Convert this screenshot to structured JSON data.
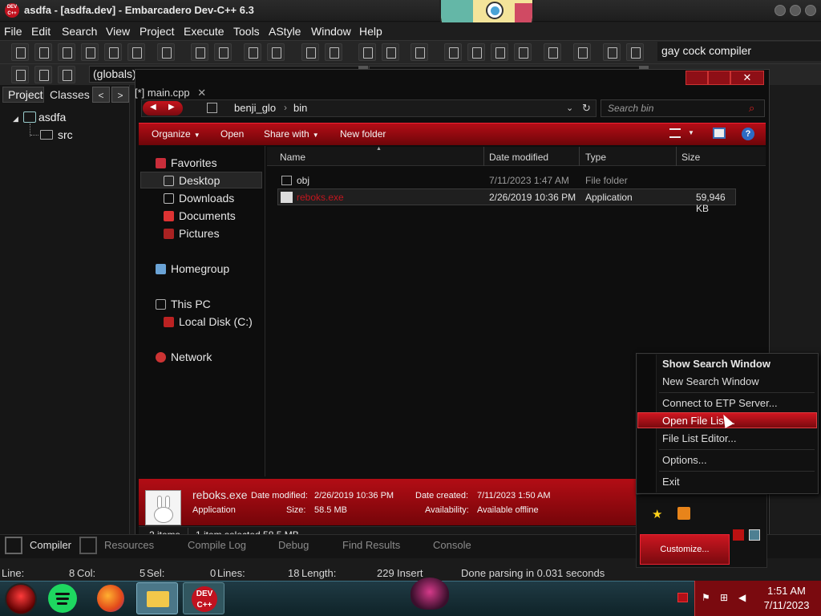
{
  "window": {
    "title": "asdfa - [asdfa.dev] - Embarcadero Dev-C++ 6.3",
    "app_icon_text": "DEV C++"
  },
  "menu": [
    "File",
    "Edit",
    "Search",
    "View",
    "Project",
    "Execute",
    "Tools",
    "AStyle",
    "Window",
    "Help"
  ],
  "toolbar": {
    "compiler": "gay cock compiler",
    "globals": "(globals)"
  },
  "project_panel": {
    "tabs": [
      "Project",
      "Classes"
    ],
    "nav_prev": "<",
    "nav_next": ">",
    "tree": {
      "project": "asdfa",
      "folder": "src"
    }
  },
  "editor": {
    "tab_label": "[*] main.cpp"
  },
  "explorer": {
    "breadcrumb": [
      "benji_glo",
      "bin"
    ],
    "search_placeholder": "Search bin",
    "commands": [
      "Organize",
      "Open",
      "Share with",
      "New folder"
    ],
    "nav": {
      "favorites": "Favorites",
      "desktop": "Desktop",
      "downloads": "Downloads",
      "documents": "Documents",
      "pictures": "Pictures",
      "homegroup": "Homegroup",
      "this_pc": "This PC",
      "local_disk": "Local Disk (C:)",
      "network": "Network"
    },
    "columns": [
      "Name",
      "Date modified",
      "Type",
      "Size"
    ],
    "files": [
      {
        "name": "obj",
        "date": "7/11/2023 1:47 AM",
        "type": "File folder",
        "size": ""
      },
      {
        "name": "reboks.exe",
        "date": "2/26/2019 10:36 PM",
        "type": "Application",
        "size": "59,946 KB"
      }
    ],
    "details": {
      "name": "reboks.exe",
      "kind": "Application",
      "date_modified_label": "Date modified:",
      "date_modified": "2/26/2019 10:36 PM",
      "size_label": "Size:",
      "size": "58.5 MB",
      "date_created_label": "Date created:",
      "date_created": "7/11/2023 1:50 AM",
      "availability_label": "Availability:",
      "availability": "Available offline"
    },
    "status": {
      "items": "2 items",
      "selected": "1 item selected  58.5 MB"
    }
  },
  "context_menu": {
    "items": [
      "Show Search Window",
      "New Search Window",
      "Connect to ETP Server...",
      "Open File List...",
      "File List Editor...",
      "Options...",
      "Exit"
    ],
    "highlighted": "Open File List..."
  },
  "tray_panel": {
    "customize": "Customize..."
  },
  "bottom_tabs": [
    "Compiler",
    "Resources",
    "Compile Log",
    "Debug",
    "Find Results",
    "Console"
  ],
  "status": {
    "line_label": "Line:",
    "line": "8",
    "col_label": "Col:",
    "col": "5",
    "sel_label": "Sel:",
    "sel": "0",
    "lines_label": "Lines:",
    "lines": "18",
    "length_label": "Length:",
    "length": "229",
    "mode": "Insert",
    "message": "Done parsing in 0.031 seconds"
  },
  "taskbar": {
    "devcpp_label": "DEV C++",
    "clock_time": "1:51 AM",
    "clock_date": "7/11/2023"
  },
  "colors": {
    "accent": "#c1121f",
    "taskbar": "#1f3a44"
  }
}
